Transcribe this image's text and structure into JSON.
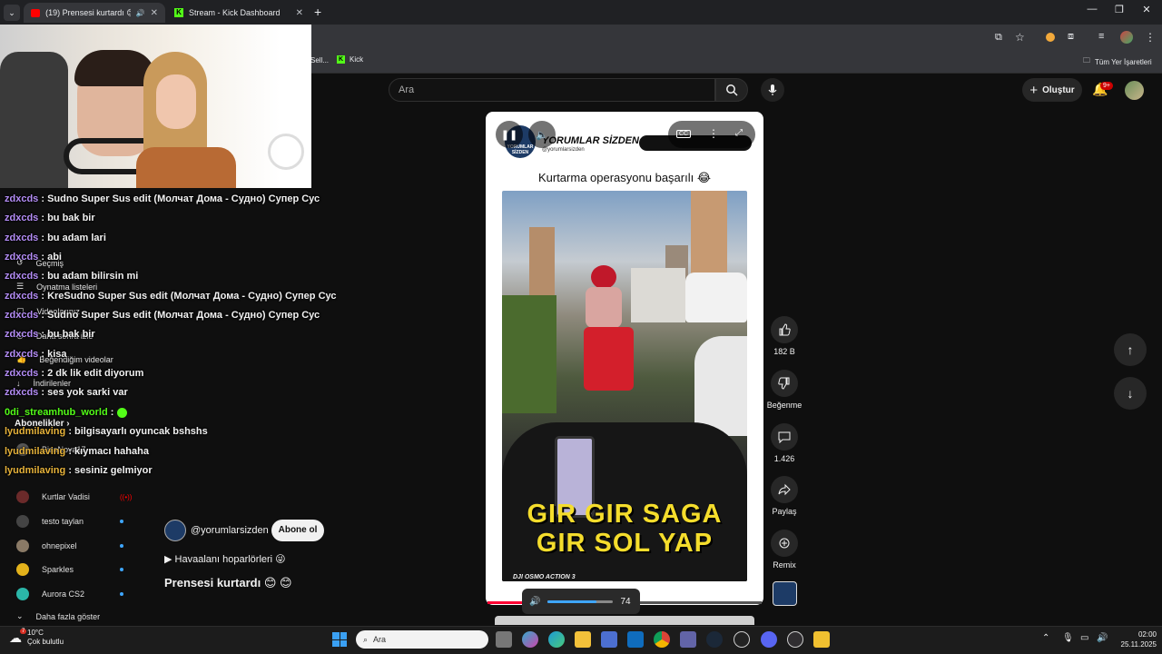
{
  "browser": {
    "tabs": [
      {
        "label": "(19) Prensesi kurtardı 😊 😊"
      },
      {
        "label": "Stream - Kick Dashboard"
      }
    ],
    "new_tab": "+",
    "bookmarks": {
      "item1": "Sell...",
      "item2": "Kick",
      "all": "Tüm Yer İşaretleri"
    }
  },
  "header": {
    "search_placeholder": "Ara",
    "create_label": "Oluştur",
    "notifications": "9+"
  },
  "short": {
    "channel_banner": "YORUMLAR SİZDEN",
    "banner_handle": "@yorumlarsizden",
    "banner_avatar_text": "YORUMLAR SİZDEN",
    "title_caption": "Kurtarma operasyonu başarılı 😂",
    "video_text_1": "GIR GIR SAGA",
    "video_text_2": "GIR SOL YAP",
    "watermark": "DJI OSMO ACTION 3",
    "volume": "74",
    "channel": "@yorumlarsizden",
    "subscribe": "Abone ol",
    "sound": "▶ Havaalanı hoparlörleri 😜",
    "title": "Prensesi kurtardı 😊 😊",
    "likes": "182 B",
    "dislike": "Beğenme",
    "comments": "1.426",
    "share": "Paylaş",
    "remix": "Remix"
  },
  "chat": [
    {
      "user": "zdxcds",
      "msg": ": Sudno Super Sus edit (Молчат Дома - Судно) Супер Сус",
      "color": "#b38cf5"
    },
    {
      "user": "zdxcds",
      "msg": ": bu bak bir",
      "color": "#b38cf5"
    },
    {
      "user": "zdxcds",
      "msg": ": bu adam lari",
      "color": "#b38cf5"
    },
    {
      "user": "zdxcds",
      "msg": ": abi",
      "color": "#b38cf5"
    },
    {
      "user": "zdxcds",
      "msg": ": bu adam bilirsin mi",
      "color": "#b38cf5"
    },
    {
      "user": "zdxcds",
      "msg": ": KreSudno Super Sus edit (Молчат Дома - Судно) Супер Сус",
      "color": "#b38cf5"
    },
    {
      "user": "zdxcds",
      "msg": ": Sudno Super Sus edit (Молчат Дома - Судно) Супер Сус",
      "color": "#b38cf5"
    },
    {
      "user": "zdxcds",
      "msg": ": bu bak bir",
      "color": "#b38cf5"
    },
    {
      "user": "zdxcds",
      "msg": ": kisa",
      "color": "#b38cf5"
    },
    {
      "user": "zdxcds",
      "msg": ": 2 dk lik edit diyorum",
      "color": "#b38cf5"
    },
    {
      "user": "zdxcds",
      "msg": ": ses yok sarki var",
      "color": "#b38cf5"
    },
    {
      "user": "0di_streamhub_world",
      "msg": ":",
      "color": "#53fc18"
    },
    {
      "user": "lyudmilaving",
      "msg": ": bilgisayarlı oyuncak bshshs",
      "color": "#e6b23a"
    },
    {
      "user": "lyudmilaving",
      "msg": ": kıymacı hahaha",
      "color": "#e6b23a"
    },
    {
      "user": "lyudmilaving",
      "msg": ": sesiniz gelmiyor",
      "color": "#e6b23a"
    }
  ],
  "sidebar": {
    "under": [
      {
        "label": "Geçmiş"
      },
      {
        "label": "Oynatma listeleri"
      },
      {
        "label": "Videolarınız"
      },
      {
        "label": "Daha sonra izle"
      },
      {
        "label": "Beğendiğim videolar"
      },
      {
        "label": "İndirilenler"
      },
      {
        "label": "Abonelikler"
      },
      {
        "label": "BizaNova17"
      }
    ],
    "subscriptions": [
      {
        "label": "Kurtlar Vadisi"
      },
      {
        "label": "testo taylan"
      },
      {
        "label": "ohnepixel"
      },
      {
        "label": "Sparkles"
      },
      {
        "label": "Aurora CS2"
      }
    ],
    "more": "Daha fazla göster"
  },
  "taskbar": {
    "weather_temp": "10°C",
    "weather_desc": "Çok bulutlu",
    "weather_badge": "7",
    "search": "Ara",
    "time": "02:00",
    "date": "25.11.2025"
  }
}
